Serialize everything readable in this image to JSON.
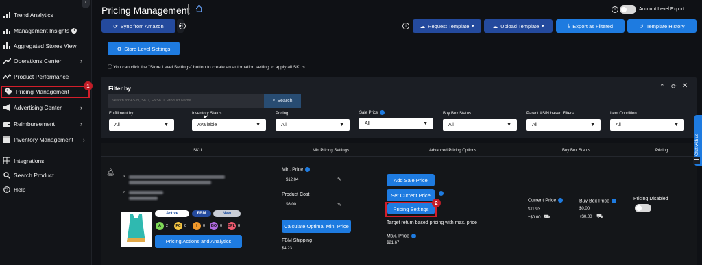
{
  "sidebar": {
    "items": [
      {
        "label": "Trend Analytics",
        "icon": "trend-icon"
      },
      {
        "label": "Management Insights",
        "icon": "bars-icon"
      },
      {
        "label": "Aggregated Stores View",
        "icon": "chart-icon"
      },
      {
        "label": "Operations Center",
        "icon": "operations-icon"
      },
      {
        "label": "Product Performance",
        "icon": "performance-icon"
      },
      {
        "label": "Pricing Management",
        "icon": "tag-icon"
      },
      {
        "label": "Advertising Center",
        "icon": "megaphone-icon"
      },
      {
        "label": "Reimbursement",
        "icon": "wallet-icon"
      },
      {
        "label": "Inventory Management",
        "icon": "box-icon"
      },
      {
        "label": "Integrations",
        "icon": "grid-icon"
      },
      {
        "label": "Search Product",
        "icon": "search-icon"
      },
      {
        "label": "Help",
        "icon": "help-icon"
      }
    ],
    "badge_1": "1"
  },
  "header": {
    "title": "Pricing Management",
    "account_level_export": "Account Level Export",
    "sync_label": "Sync from Amazon",
    "request_template": "Request Template",
    "upload_template": "Upload Template",
    "export_filtered": "Export as Filtered",
    "template_history": "Template History",
    "store_level_settings": "Store Level Settings",
    "notice": "You can click the \"Store Level Settings\" button to create an automation setting to apply all SKUs."
  },
  "filter": {
    "title": "Filter by",
    "search_placeholder": "Search for ASIN, SKU, FNSKU, Product Name",
    "search_button": "Search",
    "fields": [
      {
        "label": "Fulfillment by",
        "value": "All"
      },
      {
        "label": "Inventory Status",
        "value": "Available"
      },
      {
        "label": "Pricing",
        "value": "All"
      },
      {
        "label": "Sale Price",
        "value": "All"
      },
      {
        "label": "Buy Box Status",
        "value": "All"
      },
      {
        "label": "Parent ASIN based Filters",
        "value": "All"
      },
      {
        "label": "Item Condition",
        "value": "All"
      }
    ]
  },
  "table": {
    "headers": [
      "SKU",
      "Min Pricing Settings",
      "Advanced Pricing Options",
      "Buy Box Status",
      "Pricing"
    ],
    "row": {
      "pills": [
        "Active",
        "FBM",
        "New"
      ],
      "coins": [
        {
          "letter": "A",
          "count": "2",
          "color": "#7ed957"
        },
        {
          "letter": "FC",
          "count": "0",
          "color": "#f5c542"
        },
        {
          "letter": "I",
          "count": "0",
          "color": "#f39a2b"
        },
        {
          "letter": "BO",
          "count": "0",
          "color": "#b06be0"
        },
        {
          "letter": "3PL",
          "count": "0",
          "color": "#ef5a6f"
        }
      ],
      "pricing_actions": "Pricing Actions and Analytics",
      "min_price_label": "Min. Price",
      "min_price": "$12.04",
      "product_cost_label": "Product Cost",
      "product_cost": "$6.00",
      "calc_button": "Calculate Optimal Min. Price",
      "fbm_shipping_label": "FBM Shipping",
      "fbm_shipping": "$4.23",
      "add_sale_price": "Add Sale Price",
      "set_current_price": "Set Current Price",
      "pricing_settings": "Pricing Settings",
      "badge_2": "2",
      "target_text": "Target return based pricing with max. price",
      "max_price_label": "Max. Price",
      "max_price": "$21.67",
      "current_price_label": "Current Price",
      "current_price": "$11.93",
      "current_ship": "+$0.00",
      "buybox_price_label": "Buy Box Price",
      "buybox_price": "$0.00",
      "buybox_ship": "+$0.00",
      "pricing_disabled": "Pricing Disabled"
    }
  },
  "chat_tab": "Chat with us"
}
